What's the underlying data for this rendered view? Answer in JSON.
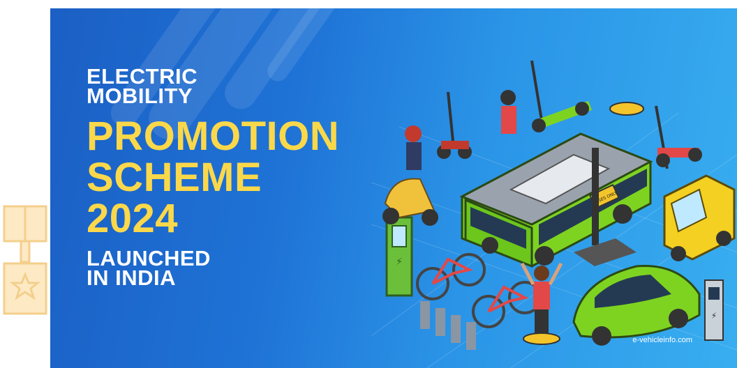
{
  "headline": {
    "line1": "ELECTRIC",
    "line2": "MOBILITY",
    "emphasis1": "PROMOTION",
    "emphasis2": "SCHEME",
    "emphasis3": "2024",
    "sub1": "LAUNCHED",
    "sub2": "IN INDIA"
  },
  "bus_sign": "BUSES ONLY",
  "watermark": "e-vehicleinfo.com",
  "colors": {
    "accent": "#fbd84a",
    "bus_green": "#7ed321",
    "background": "#2a93e6"
  },
  "icons": [
    "star-badge-icon",
    "charging-station-icon",
    "scooter-icon",
    "bicycle-icon",
    "electric-bus-icon",
    "car-icon",
    "auto-rickshaw-icon",
    "hoverboard-icon"
  ]
}
